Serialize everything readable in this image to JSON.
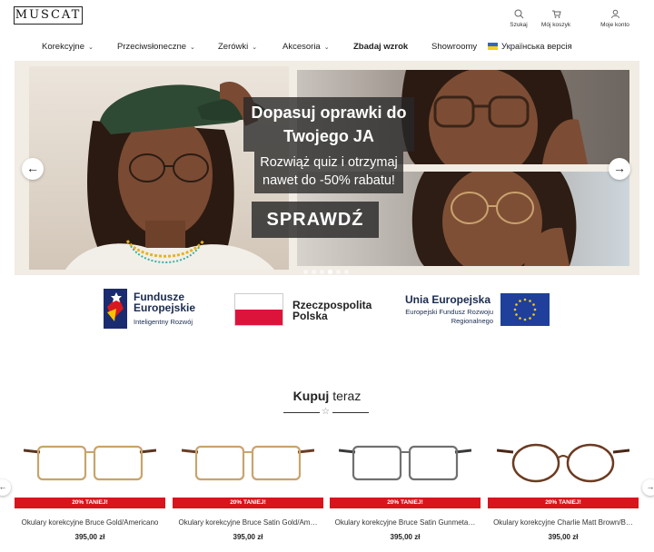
{
  "header": {
    "logo": "MUSCAT",
    "actions": [
      {
        "label": "Szukaj",
        "icon": "search-icon"
      },
      {
        "label": "Mój koszyk",
        "icon": "cart-icon"
      },
      {
        "label": "Moje konto",
        "icon": "user-icon"
      }
    ]
  },
  "nav": {
    "items": [
      {
        "label": "Korekcyjne",
        "dropdown": true
      },
      {
        "label": "Przeciwsłoneczne",
        "dropdown": true
      },
      {
        "label": "Zerówki",
        "dropdown": true
      },
      {
        "label": "Akcesoria",
        "dropdown": true
      },
      {
        "label": "Zbadaj wzrok",
        "bold": true
      },
      {
        "label": "Showroomy"
      },
      {
        "label": "Українська версія",
        "icon": "ukraine-flag-icon"
      }
    ]
  },
  "hero": {
    "title_line1": "Dopasuj oprawki do",
    "title_line2": "Twojego JA",
    "subtitle_line1": "Rozwiąż quiz i otrzymaj",
    "subtitle_line2": "nawet do -50% rabatu!",
    "cta": "SPRAWDŹ",
    "prev_icon": "arrow-left-icon",
    "next_icon": "arrow-right-icon",
    "slides": 6,
    "active_slide": 4
  },
  "funding": {
    "fe_title": "Fundusze Europejskie",
    "fe_sub": "Inteligentny Rozwój",
    "pl_title": "Rzeczpospolita Polska",
    "eu_title": "Unia Europejska",
    "eu_sub": "Europejski Fundusz Rozwoju Regionalnego"
  },
  "section": {
    "title_bold": "Kupuj",
    "title_rest": "teraz"
  },
  "colors": {
    "badge": "#d8151c",
    "eu_blue": "#1f3f9b",
    "pl_red": "#dc143c"
  },
  "products": [
    {
      "badge": "20% TANIEJ!",
      "name": "Okulary korekcyjne Bruce Gold/Americano",
      "price": "395,00 zł",
      "frame": "#c8a46a",
      "temple": "#5a3520"
    },
    {
      "badge": "20% TANIEJ!",
      "name": "Okulary korekcyjne Bruce Satin Gold/Am…",
      "price": "395,00 zł",
      "frame": "#c9a36f",
      "temple": "#6a3d24"
    },
    {
      "badge": "20% TANIEJ!",
      "name": "Okulary korekcyjne Bruce Satin Gunmeta…",
      "price": "395,00 zł",
      "frame": "#707070",
      "temple": "#3a3a3a"
    },
    {
      "badge": "20% TANIEJ!",
      "name": "Okulary korekcyjne Charlie Matt Brown/B…",
      "price": "395,00 zł",
      "frame": "#6b3b22",
      "temple": "#4a2616"
    }
  ]
}
